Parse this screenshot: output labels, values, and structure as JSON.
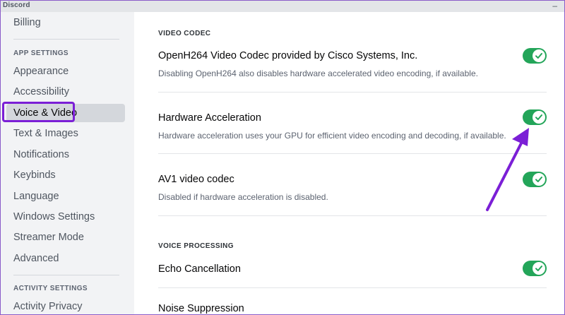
{
  "window": {
    "title": "Discord",
    "control": "–"
  },
  "sidebar": {
    "top_item": "Billing",
    "app_settings_header": "APP SETTINGS",
    "items": [
      "Appearance",
      "Accessibility",
      "Voice & Video",
      "Text & Images",
      "Notifications",
      "Keybinds",
      "Language",
      "Windows Settings",
      "Streamer Mode",
      "Advanced"
    ],
    "selected_item": "Voice & Video",
    "activity_settings_header": "ACTIVITY SETTINGS",
    "activity_items": [
      "Activity Privacy"
    ]
  },
  "main": {
    "video_codec_header": "VIDEO CODEC",
    "settings": [
      {
        "title": "OpenH264 Video Codec provided by Cisco Systems, Inc.",
        "description": "Disabling OpenH264 also disables hardware accelerated video encoding, if available.",
        "enabled": true
      },
      {
        "title": "Hardware Acceleration",
        "description": "Hardware acceleration uses your GPU for efficient video encoding and decoding, if available.",
        "enabled": true
      },
      {
        "title": "AV1 video codec",
        "description": "Disabled if hardware acceleration is disabled.",
        "enabled": true
      }
    ],
    "voice_processing_header": "VOICE PROCESSING",
    "voice_settings": [
      {
        "title": "Echo Cancellation",
        "enabled": true
      },
      {
        "title": "Noise Suppression"
      }
    ]
  },
  "colors": {
    "toggle_on": "#23a559",
    "annotation": "#7b1fd6",
    "sidebar_bg": "#f2f3f5",
    "selected_bg": "#d4d7dc"
  },
  "icons": {
    "toggle_check": "check-icon",
    "annotation_arrow": "arrow-annotation"
  }
}
